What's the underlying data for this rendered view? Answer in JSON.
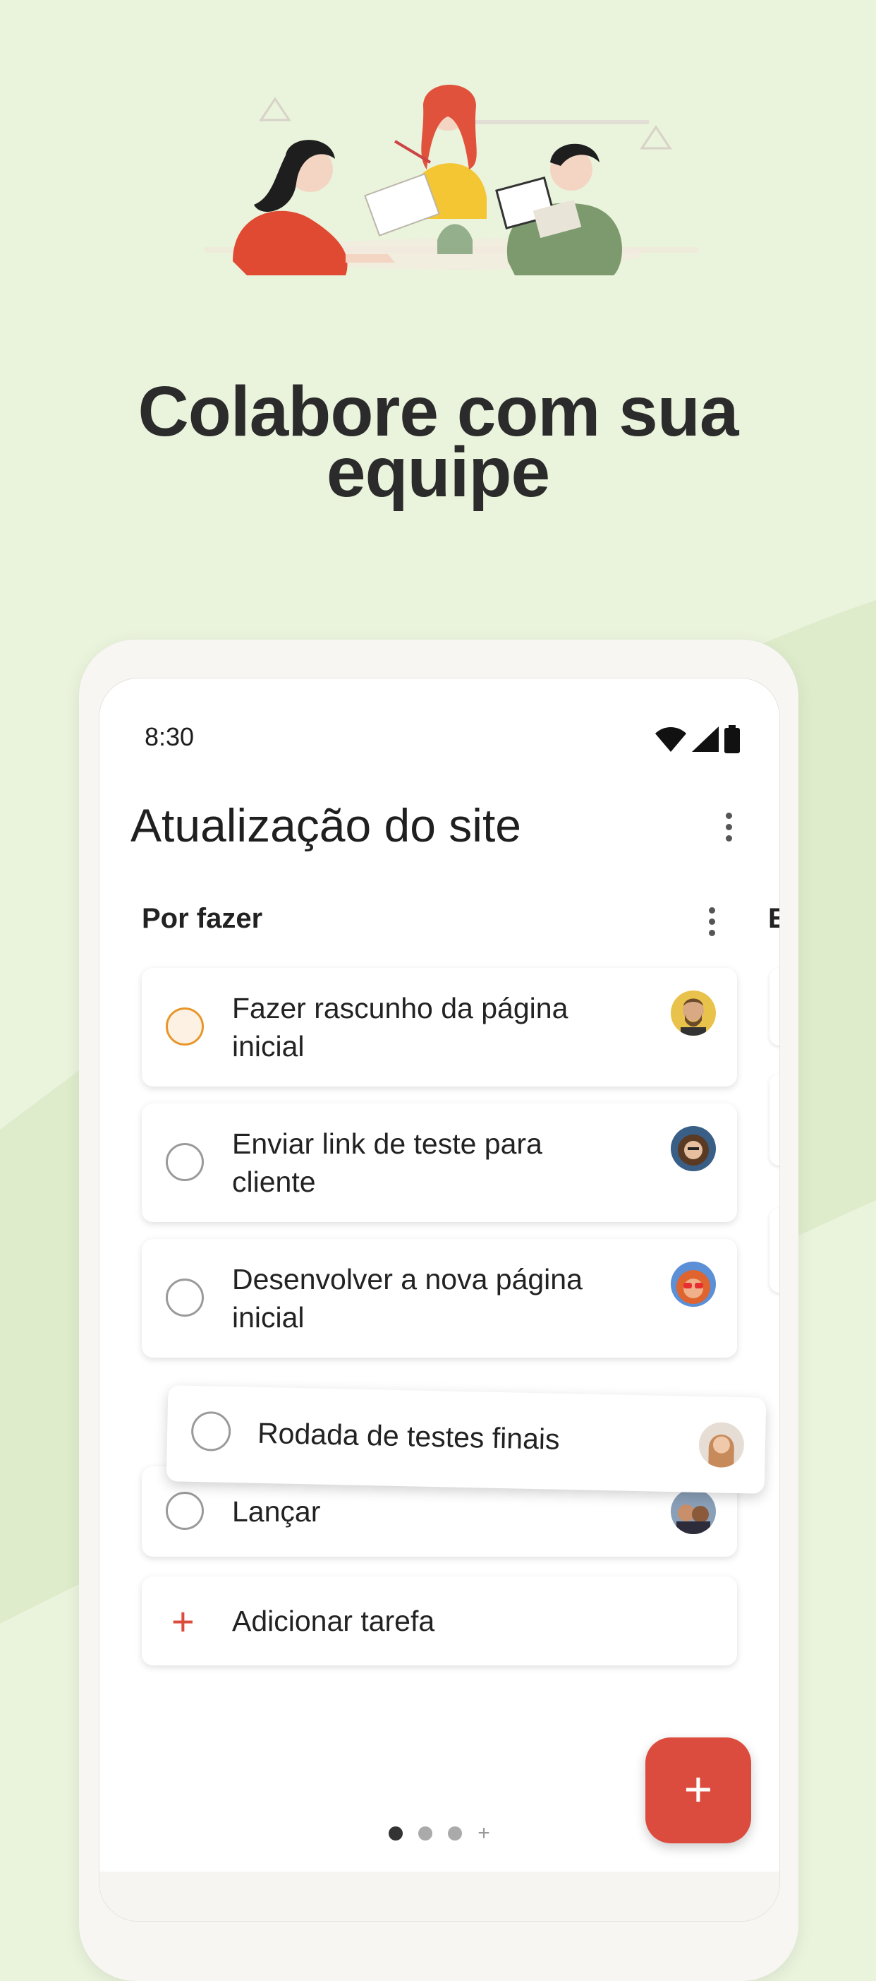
{
  "headline": {
    "line1": "Colabore com sua",
    "line2": "equipe"
  },
  "status_bar": {
    "time": "8:30"
  },
  "project": {
    "title": "Atualização do site"
  },
  "section": {
    "title": "Por fazer",
    "next_column_initial": "E"
  },
  "tasks": [
    {
      "label": "Fazer rascunho da página inicial",
      "priority": "p1",
      "avatar": "avatar-beard-man"
    },
    {
      "label": "Enviar link de teste para cliente",
      "priority": "none",
      "avatar": "avatar-curly-hair"
    },
    {
      "label": "Desenvolver a nova página inicial",
      "priority": "none",
      "avatar": "avatar-sunglasses"
    },
    {
      "label": "Lançar",
      "priority": "none",
      "avatar": "avatar-couple"
    }
  ],
  "dragging_task": {
    "label": "Rodada de testes finais",
    "avatar": "avatar-woman"
  },
  "add_task": {
    "label": "Adicionar tarefa"
  },
  "fab": {
    "label": "+"
  },
  "pager": {
    "pages": 3,
    "active_index": 0
  },
  "colors": {
    "background": "#eaf3dc",
    "accent": "#dc4c3e",
    "priority1": "#e8962a"
  }
}
